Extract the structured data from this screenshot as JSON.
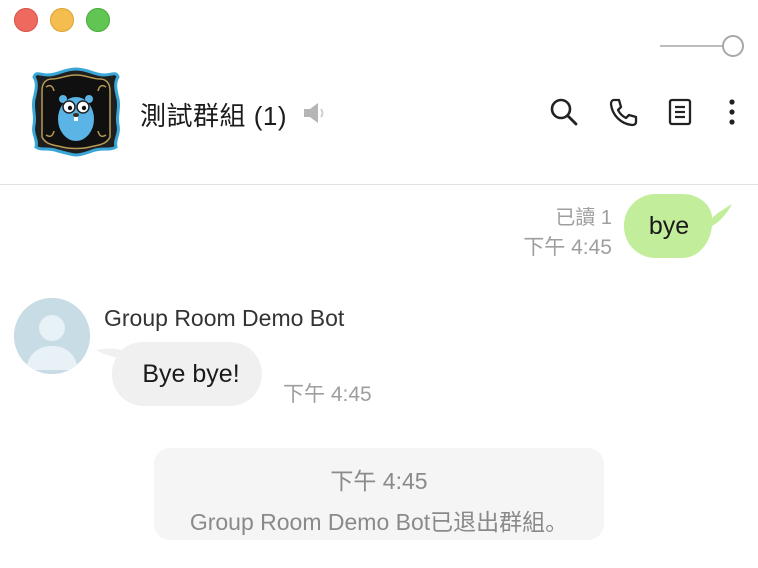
{
  "window": {
    "controls": [
      "close",
      "minimize",
      "zoom"
    ]
  },
  "header": {
    "group_name": "測試群組 (1)",
    "avatar_icon": "go-gopher-avatar-icon",
    "icons": [
      "speaker-icon",
      "search-icon",
      "phone-icon",
      "notes-icon",
      "more-icon"
    ]
  },
  "messages": {
    "mine": {
      "read_label": "已讀 1",
      "time": "下午 4:45",
      "text": "bye",
      "bubble_color": "#c2ed9b"
    },
    "bot": {
      "sender": "Group Room Demo Bot",
      "text": "Bye bye!",
      "time": "下午 4:45",
      "bubble_color": "#f0f0f0"
    },
    "system": {
      "time": "下午 4:45",
      "text": "Group Room Demo Bot已退出群組。"
    }
  }
}
